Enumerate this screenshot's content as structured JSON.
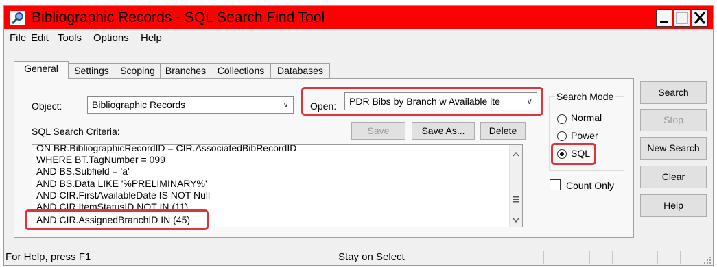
{
  "window": {
    "title": "Bibliographic Records - SQL Search Find Tool"
  },
  "menu": [
    "File",
    "Edit",
    "Tools",
    "Options",
    "Help"
  ],
  "tabs": [
    "General",
    "Settings",
    "Scoping",
    "Branches",
    "Collections",
    "Databases"
  ],
  "form": {
    "object_label": "Object:",
    "object_value": "Bibliographic Records",
    "open_label": "Open:",
    "open_value": "PDR Bibs by Branch w Available ite",
    "criteria_label": "SQL Search Criteria:",
    "save_label": "Save",
    "save_as_label": "Save As...",
    "delete_label": "Delete"
  },
  "sql_lines": [
    "ON BR.BibliographicRecordID = CIR.AssociatedBibRecordID",
    "WHERE BT.TagNumber = 099",
    "AND BS.Subfield = 'a'",
    "AND BS.Data LIKE '%PRELIMINARY%'",
    "AND CIR.FirstAvailableDate IS NOT Null",
    "AND CIR.ItemStatusID NOT IN (11)",
    "AND CIR.AssignedBranchID IN (45)"
  ],
  "search_mode": {
    "label": "Search Mode",
    "options": [
      "Normal",
      "Power",
      "SQL"
    ],
    "selected": "SQL"
  },
  "count_only_label": "Count Only",
  "side_buttons": {
    "search": "Search",
    "stop": "Stop",
    "new_search": "New Search",
    "clear": "Clear",
    "help": "Help"
  },
  "status": {
    "help_text": "For Help, press F1",
    "mode_text": "Stay on Select"
  },
  "colors": {
    "title_bar": "#ff0000",
    "highlight": "#d9363e"
  }
}
